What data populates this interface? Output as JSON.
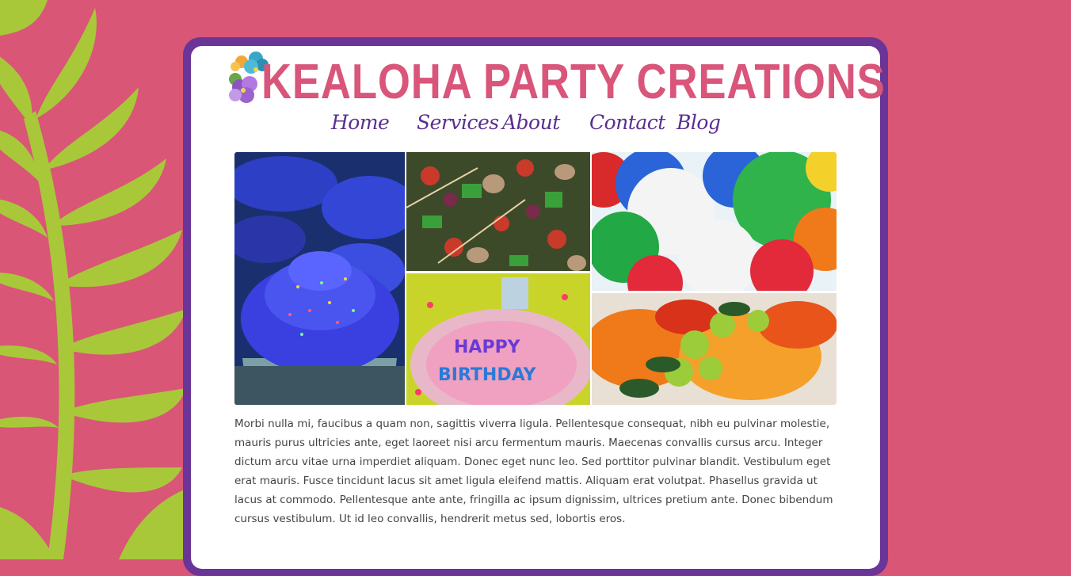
{
  "header": {
    "title": "KEALOHA PARTY CREATIONS"
  },
  "nav": {
    "items": [
      {
        "label": "Home"
      },
      {
        "label": "Services"
      },
      {
        "label": "About"
      },
      {
        "label": "Contact"
      },
      {
        "label": "Blog"
      }
    ]
  },
  "gallery": {
    "images": [
      {
        "name": "cupcakes-photo"
      },
      {
        "name": "kebabs-photo"
      },
      {
        "name": "balloons-photo"
      },
      {
        "name": "birthday-plate-photo"
      },
      {
        "name": "tropical-flowers-photo"
      }
    ]
  },
  "content": {
    "paragraph": "Morbi nulla mi, faucibus a quam non, sagittis viverra ligula. Pellentesque consequat, nibh eu pulvinar molestie, mauris purus ultricies ante, eget laoreet nisi arcu fermentum mauris. Maecenas convallis cursus arcu. Integer dictum arcu vitae urna imperdiet aliquam. Donec eget nunc leo. Sed porttitor pulvinar blandit. Vestibulum eget erat mauris. Fusce tincidunt lacus sit amet ligula eleifend mattis. Aliquam erat volutpat. Phasellus gravida ut lacus at commodo. Pellentesque ante ante, fringilla ac ipsum dignissim, ultrices pretium ante. Donec bibendum cursus vestibulum. Ut id leo convallis, hendrerit metus sed, lobortis eros."
  },
  "colors": {
    "background": "#d95676",
    "frame": "#6a3596",
    "title": "#d9557a",
    "nav": "#5a2f8f",
    "leaf": "#a8c83a"
  }
}
